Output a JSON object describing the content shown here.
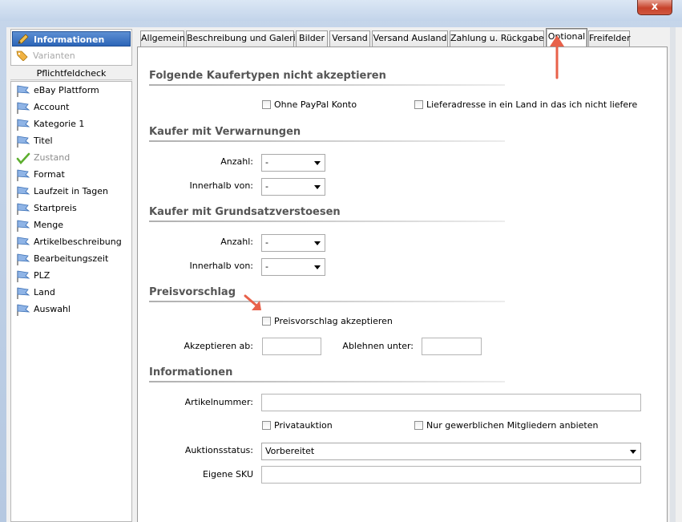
{
  "window": {
    "close_label": "x"
  },
  "sidebar": {
    "menu": [
      {
        "label": "Informationen",
        "icon": "pencil-icon",
        "selected": true
      },
      {
        "label": "Varianten",
        "icon": "tags-icon",
        "disabled": true
      }
    ],
    "check_header": "Pflichtfeldcheck",
    "check_items": [
      {
        "label": "eBay Plattform",
        "status": "flag"
      },
      {
        "label": "Account",
        "status": "flag"
      },
      {
        "label": "Kategorie 1",
        "status": "flag"
      },
      {
        "label": "Titel",
        "status": "flag"
      },
      {
        "label": "Zustand",
        "status": "check"
      },
      {
        "label": "Format",
        "status": "flag"
      },
      {
        "label": "Laufzeit in Tagen",
        "status": "flag"
      },
      {
        "label": "Startpreis",
        "status": "flag"
      },
      {
        "label": "Menge",
        "status": "flag"
      },
      {
        "label": "Artikelbeschreibung",
        "status": "flag"
      },
      {
        "label": "Bearbeitungszeit",
        "status": "flag"
      },
      {
        "label": "PLZ",
        "status": "flag"
      },
      {
        "label": "Land",
        "status": "flag"
      },
      {
        "label": "Auswahl",
        "status": "flag"
      }
    ]
  },
  "tabs": [
    {
      "label": "Allgemein"
    },
    {
      "label": "Beschreibung und Galerie"
    },
    {
      "label": "Bilder"
    },
    {
      "label": "Versand"
    },
    {
      "label": "Versand Ausland"
    },
    {
      "label": "Zahlung u. Rückgabe"
    },
    {
      "label": "Optional",
      "active": true
    },
    {
      "label": "Freifelder"
    }
  ],
  "sections": {
    "buyer_types": {
      "title": "Folgende Kaufertypen nicht akzeptieren",
      "no_paypal": "Ohne PayPal Konto",
      "no_ship_country": "Lieferadresse in ein Land in das ich nicht liefere"
    },
    "warnings": {
      "title": "Kaufer mit Verwarnungen",
      "count_label": "Anzahl:",
      "count_value": "-",
      "within_label": "Innerhalb von:",
      "within_value": "-"
    },
    "violations": {
      "title": "Kaufer mit Grundsatzverstoesen",
      "count_label": "Anzahl:",
      "count_value": "-",
      "within_label": "Innerhalb von:",
      "within_value": "-"
    },
    "best_offer": {
      "title": "Preisvorschlag",
      "accept_label": "Preisvorschlag akzeptieren",
      "accept_from_label": "Akzeptieren ab:",
      "accept_from_value": "",
      "reject_below_label": "Ablehnen unter:",
      "reject_below_value": ""
    },
    "info": {
      "title": "Informationen",
      "article_number_label": "Artikelnummer:",
      "article_number_value": "",
      "private_auction": "Privatauktion",
      "business_only": "Nur gewerblichen Mitgliedern anbieten",
      "status_label": "Auktionsstatus:",
      "status_value": "Vorbereitet",
      "sku_label": "Eigene SKU",
      "sku_value": ""
    }
  },
  "colors": {
    "accent": "#2c65b8",
    "annotation_arrow": "#e8614a"
  }
}
